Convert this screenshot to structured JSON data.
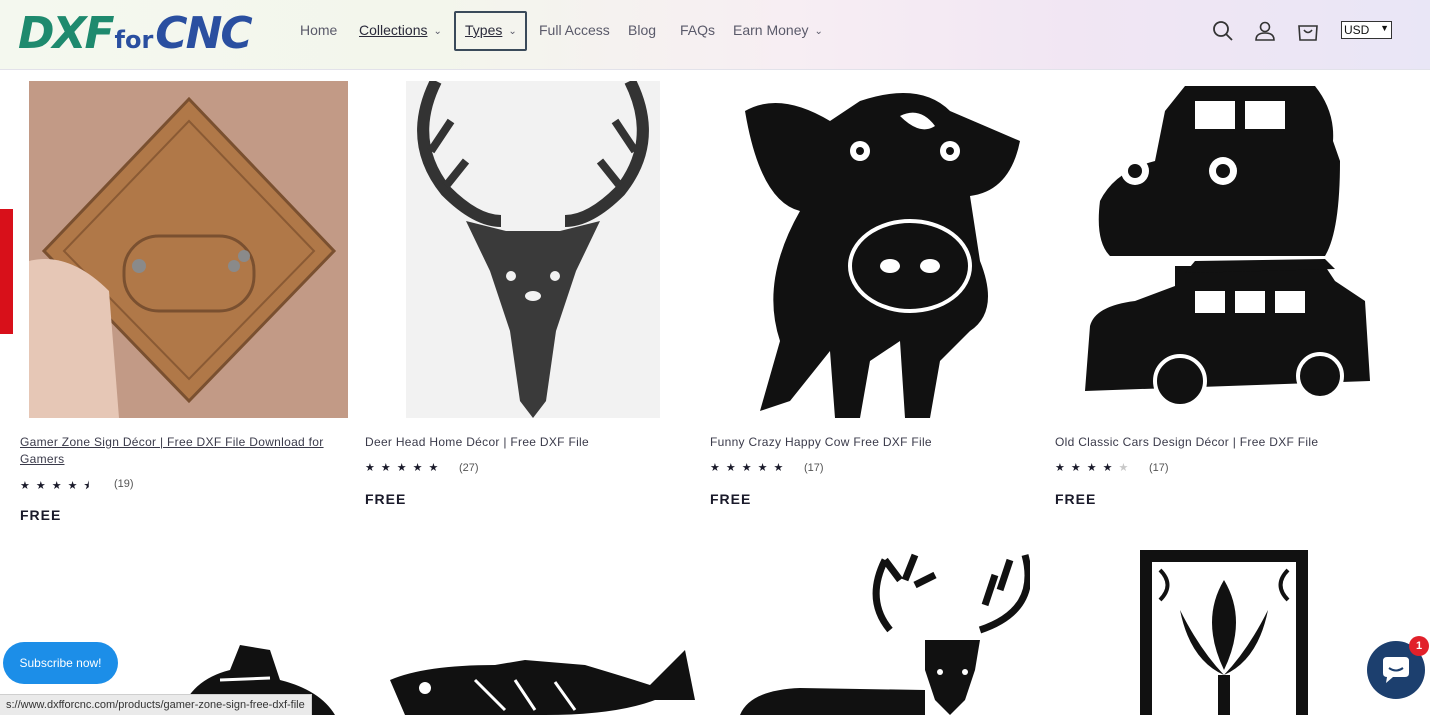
{
  "header": {
    "logo": {
      "part1": "DXF",
      "part2": "for",
      "part3": "CNC"
    },
    "nav": [
      {
        "label": "Home",
        "dropdown": false
      },
      {
        "label": "Collections",
        "dropdown": true
      },
      {
        "label": "Types",
        "dropdown": true
      },
      {
        "label": "Full Access",
        "dropdown": false
      },
      {
        "label": "Blog",
        "dropdown": false
      },
      {
        "label": "FAQs",
        "dropdown": false
      },
      {
        "label": "Earn Money",
        "dropdown": true
      }
    ],
    "icons": [
      "search-icon",
      "account-icon",
      "cart-icon"
    ],
    "currency": "USD"
  },
  "products": [
    {
      "title": "Gamer Zone Sign Décor | Free DXF File Download for Gamers",
      "rating": 4.5,
      "stars": "★★★★⯨",
      "count": "(19)",
      "price": "FREE"
    },
    {
      "title": "Deer Head Home Décor | Free DXF File",
      "rating": 5,
      "stars": "★★★★★",
      "count": "(27)",
      "price": "FREE"
    },
    {
      "title": "Funny Crazy Happy Cow Free DXF File",
      "rating": 5,
      "stars": "★★★★★",
      "count": "(17)",
      "price": "FREE"
    },
    {
      "title": "Old Classic Cars Design Décor | Free DXF File",
      "rating": 4,
      "stars": "★★★★",
      "count": "(17)",
      "price": "FREE"
    }
  ],
  "widgets": {
    "subscribe": "Subscribe now!",
    "status_url": "s://www.dxfforcnc.com/products/gamer-zone-sign-free-dxf-file",
    "chat_badge": "1"
  },
  "colors": {
    "logo_green": "#1e8a6e",
    "logo_blue": "#2a4fa0",
    "subscribe_blue": "#1c8ee8",
    "chat_navy": "#1c3f6e",
    "side_tab_red": "#d8101a"
  }
}
